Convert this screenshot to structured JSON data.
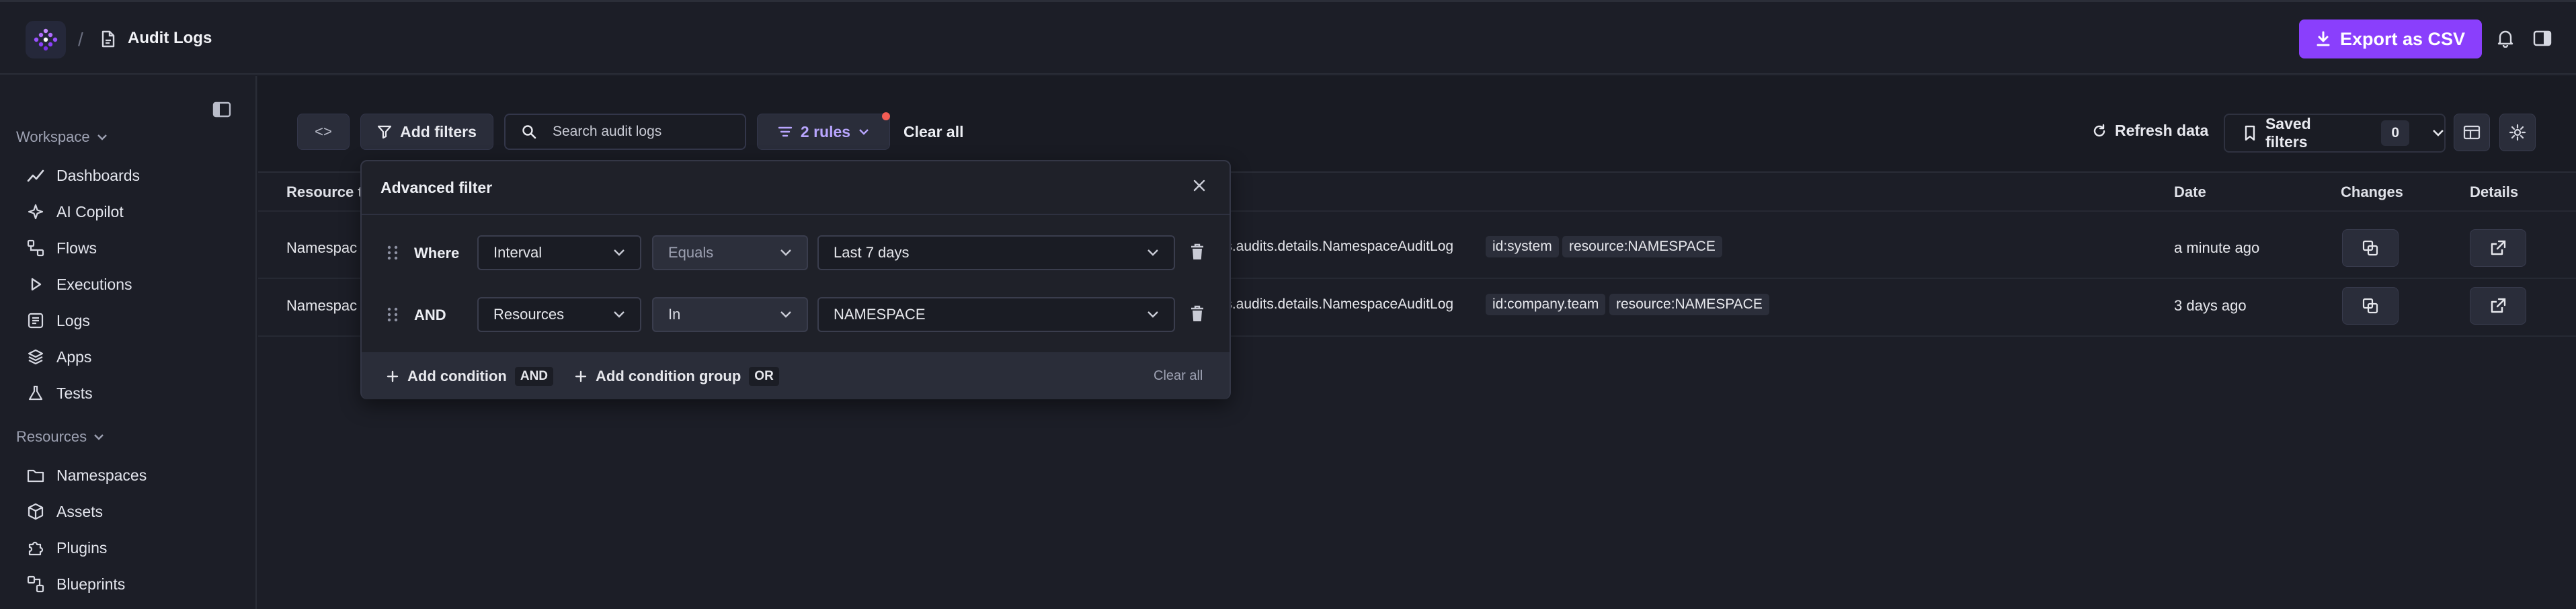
{
  "header": {
    "breadcrumb_separator": "/",
    "page_title": "Audit Logs",
    "export_label": "Export as CSV"
  },
  "sidebar": {
    "workspace_label": "Workspace",
    "workspace_items": [
      {
        "label": "Dashboards",
        "icon": "chart-line-icon"
      },
      {
        "label": "AI Copilot",
        "icon": "sparkle-icon"
      },
      {
        "label": "Flows",
        "icon": "flow-icon"
      },
      {
        "label": "Executions",
        "icon": "play-icon"
      },
      {
        "label": "Logs",
        "icon": "logs-icon"
      },
      {
        "label": "Apps",
        "icon": "layers-icon"
      },
      {
        "label": "Tests",
        "icon": "flask-icon"
      }
    ],
    "resources_label": "Resources",
    "resources_items": [
      {
        "label": "Namespaces",
        "icon": "folder-icon"
      },
      {
        "label": "Assets",
        "icon": "cube-icon"
      },
      {
        "label": "Plugins",
        "icon": "puzzle-icon"
      },
      {
        "label": "Blueprints",
        "icon": "blueprint-icon"
      }
    ]
  },
  "toolbar": {
    "code_toggle": "<>",
    "add_filters_label": "Add filters",
    "search_placeholder": "Search audit logs",
    "rules_label": "2 rules",
    "clear_all_label": "Clear all",
    "refresh_label": "Refresh data",
    "saved_filters_label": "Saved filters",
    "saved_filters_count": "0"
  },
  "table": {
    "columns": {
      "resource_type": "Resource t",
      "date": "Date",
      "changes": "Changes",
      "details": "Details"
    },
    "rows": [
      {
        "resource_type": "Namespac",
        "tags": [
          "els.audits.details.NamespaceAuditLog",
          "id:system",
          "resource:NAMESPACE"
        ],
        "date": "a minute ago"
      },
      {
        "resource_type": "Namespac",
        "tags": [
          "els.audits.details.NamespaceAuditLog",
          "id:company.team",
          "resource:NAMESPACE"
        ],
        "date": "3 days ago"
      }
    ]
  },
  "advanced_filter": {
    "title": "Advanced filter",
    "conditions": [
      {
        "label": "Where",
        "field": "Interval",
        "operator": "Equals",
        "value": "Last 7 days"
      },
      {
        "label": "AND",
        "field": "Resources",
        "operator": "In",
        "value": "NAMESPACE"
      }
    ],
    "add_condition_label": "Add condition",
    "add_condition_chip": "AND",
    "add_group_label": "Add condition group",
    "add_group_chip": "OR",
    "footer_clear_label": "Clear all"
  },
  "colors": {
    "accent": "#8a3ffc",
    "background": "#1c1e27",
    "badge_dot": "#f25c54"
  }
}
